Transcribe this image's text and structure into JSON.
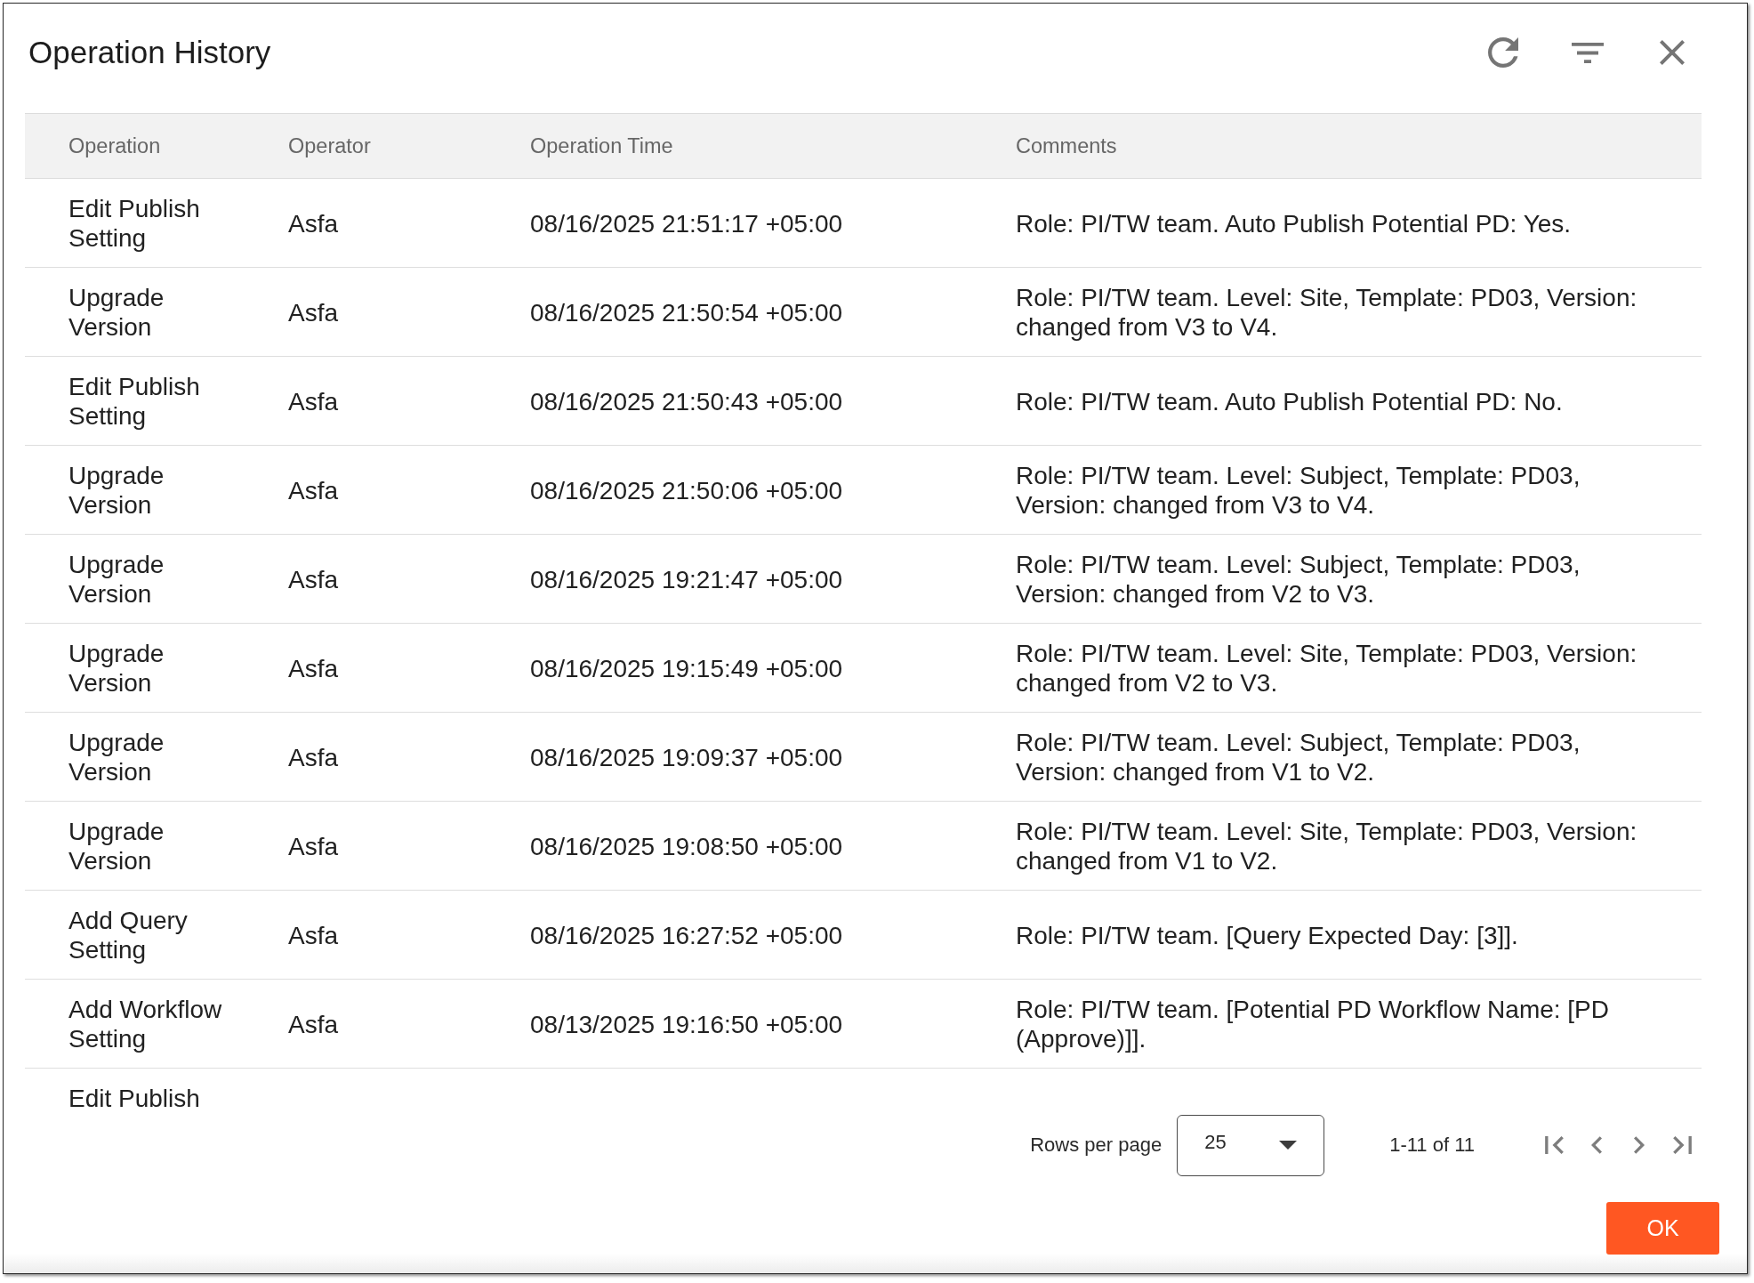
{
  "dialog": {
    "title": "Operation History"
  },
  "table": {
    "columns": [
      "Operation",
      "Operator",
      "Operation Time",
      "Comments"
    ],
    "rows": [
      {
        "operation": "Edit Publish Setting",
        "operator": "Asfa",
        "time": "08/16/2025 21:51:17 +05:00",
        "comments": "Role: PI/TW team. Auto Publish Potential PD: Yes."
      },
      {
        "operation": "Upgrade Version",
        "operator": "Asfa",
        "time": "08/16/2025 21:50:54 +05:00",
        "comments": "Role: PI/TW team. Level: Site, Template: PD03, Version: changed from V3 to V4."
      },
      {
        "operation": "Edit Publish Setting",
        "operator": "Asfa",
        "time": "08/16/2025 21:50:43 +05:00",
        "comments": "Role: PI/TW team. Auto Publish Potential PD: No."
      },
      {
        "operation": "Upgrade Version",
        "operator": "Asfa",
        "time": "08/16/2025 21:50:06 +05:00",
        "comments": "Role: PI/TW team. Level: Subject, Template: PD03, Version: changed from V3 to V4."
      },
      {
        "operation": "Upgrade Version",
        "operator": "Asfa",
        "time": "08/16/2025 19:21:47 +05:00",
        "comments": "Role: PI/TW team. Level: Subject, Template: PD03, Version: changed from V2 to V3."
      },
      {
        "operation": "Upgrade Version",
        "operator": "Asfa",
        "time": "08/16/2025 19:15:49 +05:00",
        "comments": "Role: PI/TW team. Level: Site, Template: PD03, Version: changed from V2 to V3."
      },
      {
        "operation": "Upgrade Version",
        "operator": "Asfa",
        "time": "08/16/2025 19:09:37 +05:00",
        "comments": "Role: PI/TW team. Level: Subject, Template: PD03, Version: changed from V1 to V2."
      },
      {
        "operation": "Upgrade Version",
        "operator": "Asfa",
        "time": "08/16/2025 19:08:50 +05:00",
        "comments": "Role: PI/TW team. Level: Site, Template: PD03, Version: changed from V1 to V2."
      },
      {
        "operation": "Add Query Setting",
        "operator": "Asfa",
        "time": "08/16/2025 16:27:52 +05:00",
        "comments": "Role: PI/TW team. [Query Expected Day: [3]]."
      },
      {
        "operation": "Add Workflow Setting",
        "operator": "Asfa",
        "time": "08/13/2025 19:16:50 +05:00",
        "comments": "Role: PI/TW team. [Potential PD Workflow Name: [PD (Approve)]]."
      },
      {
        "operation": "Edit Publish"
      }
    ]
  },
  "pagination": {
    "rows_per_page_label": "Rows per page",
    "rows_per_page": "25",
    "range": "1-11 of 11"
  },
  "ok_button": {
    "label": "OK"
  }
}
